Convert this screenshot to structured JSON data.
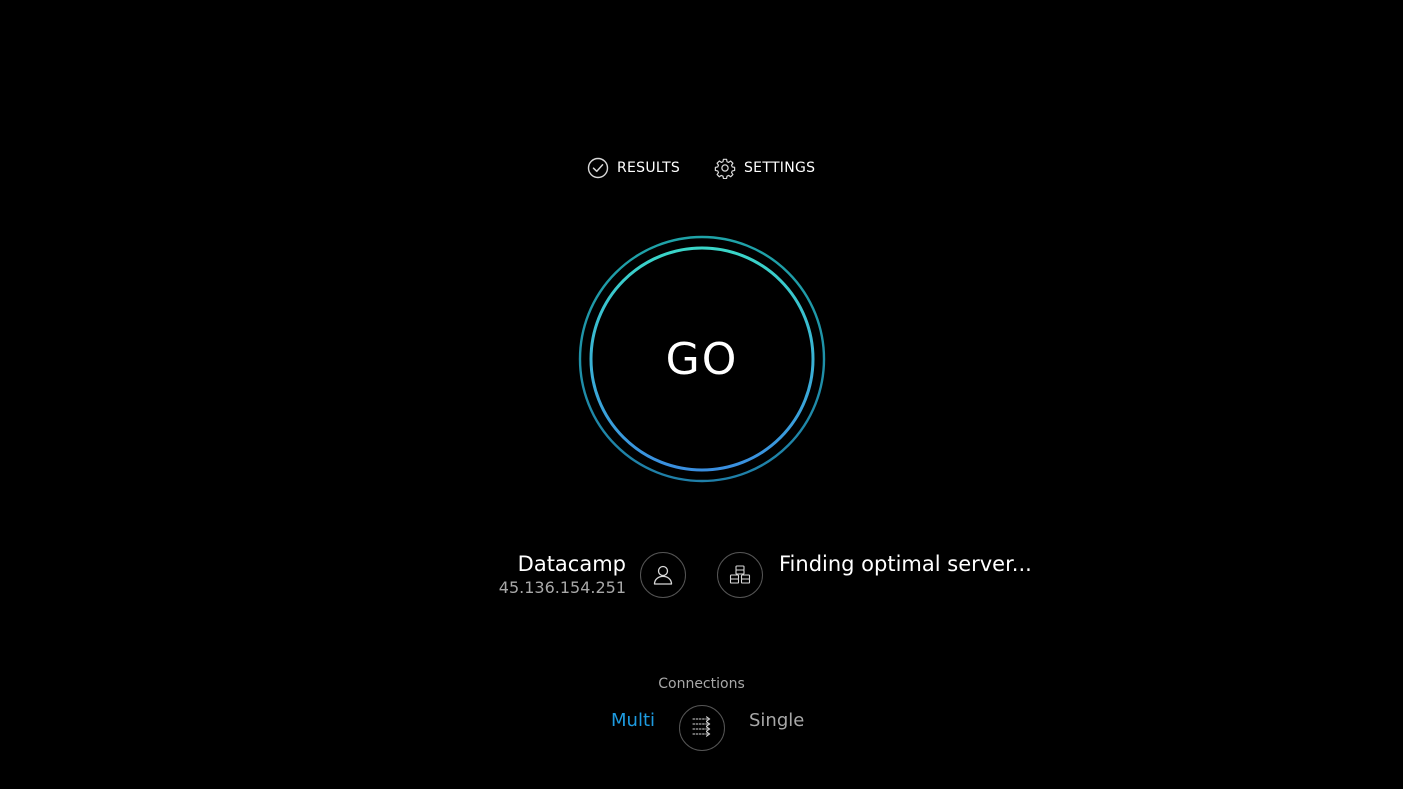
{
  "nav": {
    "results_label": "RESULTS",
    "settings_label": "SETTINGS",
    "results_icon": "check-circle-icon",
    "settings_icon": "gear-icon"
  },
  "go": {
    "label": "GO"
  },
  "isp": {
    "name": "Datacamp",
    "ip": "45.136.154.251",
    "icon": "user-icon"
  },
  "server": {
    "status": "Finding optimal server...",
    "icon": "server-stack-icon"
  },
  "connections": {
    "label": "Connections",
    "multi_label": "Multi",
    "single_label": "Single",
    "selected": "Multi",
    "toggle_icon": "connections-arrows-icon"
  },
  "colors": {
    "background": "#000000",
    "ring_inner_start": "#3ad6c8",
    "ring_inner_end": "#3a8fe0",
    "ring_outer": "#1f8fa8",
    "accent_selected": "#1e9be0",
    "muted_text": "#a8a8a8"
  }
}
